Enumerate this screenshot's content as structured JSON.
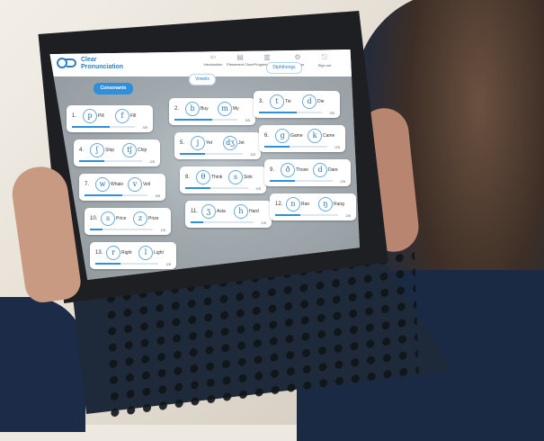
{
  "app": {
    "brand_line1": "Clear",
    "brand_line2": "Pronunciation",
    "nav": [
      {
        "label": "Introduction",
        "icon": "arrow-left-icon"
      },
      {
        "label": "Placement Chart",
        "icon": "document-icon"
      },
      {
        "label": "Progress Report",
        "icon": "chart-icon"
      },
      {
        "label": "Settings",
        "icon": "gear-icon"
      },
      {
        "label": "Sign out",
        "icon": "signout-icon"
      }
    ]
  },
  "tabs": [
    {
      "label": "Consonants",
      "active": true
    },
    {
      "label": "Vowels",
      "active": false
    },
    {
      "label": "Diphthongs",
      "active": false
    }
  ],
  "cards": [
    {
      "num": "1.",
      "sym1": "p",
      "word1": "Pill",
      "sym2": "f",
      "word2": "Fill",
      "score": "3/5",
      "progress": 0.6
    },
    {
      "num": "2.",
      "sym1": "b",
      "word1": "Buy",
      "sym2": "m",
      "word2": "My",
      "score": "3/5",
      "progress": 0.6
    },
    {
      "num": "3.",
      "sym1": "t",
      "word1": "Tie",
      "sym2": "d",
      "word2": "Die",
      "score": "3/5",
      "progress": 0.6
    },
    {
      "num": "4.",
      "sym1": "ʃ",
      "word1": "Ship",
      "sym2": "tʃ",
      "word2": "Chip",
      "score": "2/5",
      "progress": 0.4
    },
    {
      "num": "5.",
      "sym1": "j",
      "word1": "Yet",
      "sym2": "dʒ",
      "word2": "Jet",
      "score": "2/5",
      "progress": 0.4
    },
    {
      "num": "6.",
      "sym1": "g",
      "word1": "Game",
      "sym2": "k",
      "word2": "Came",
      "score": "2/5",
      "progress": 0.4
    },
    {
      "num": "7.",
      "sym1": "w",
      "word1": "Whale",
      "sym2": "v",
      "word2": "Veil",
      "score": "3/5",
      "progress": 0.6
    },
    {
      "num": "8.",
      "sym1": "θ",
      "word1": "Think",
      "sym2": "s",
      "word2": "Sink",
      "score": "2/5",
      "progress": 0.4
    },
    {
      "num": "9.",
      "sym1": "ð",
      "word1": "Those",
      "sym2": "d",
      "word2": "Dare",
      "score": "2/5",
      "progress": 0.4
    },
    {
      "num": "10.",
      "sym1": "s",
      "word1": "Price",
      "sym2": "z",
      "word2": "Prize",
      "score": "1/5",
      "progress": 0.2
    },
    {
      "num": "11.",
      "sym1": "ʒ",
      "word1": "Asia",
      "sym2": "h",
      "word2": "Hard",
      "score": "1/5",
      "progress": 0.2
    },
    {
      "num": "12.",
      "sym1": "n",
      "word1": "Ran",
      "sym2": "ŋ",
      "word2": "Rang",
      "score": "2/5",
      "progress": 0.4
    },
    {
      "num": "13.",
      "sym1": "r",
      "word1": "Right",
      "sym2": "l",
      "word2": "Light",
      "score": "2/5",
      "progress": 0.4
    }
  ]
}
